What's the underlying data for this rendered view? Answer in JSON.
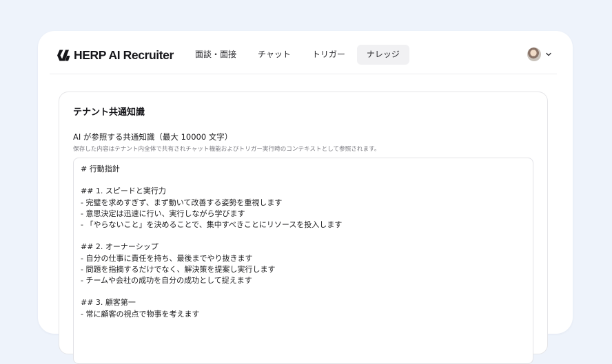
{
  "app": {
    "brand": "HERP AI Recruiter",
    "nav": [
      {
        "label": "面談・面接",
        "active": false
      },
      {
        "label": "チャット",
        "active": false
      },
      {
        "label": "トリガー",
        "active": false
      },
      {
        "label": "ナレッジ",
        "active": true
      }
    ]
  },
  "knowledge": {
    "section_title": "テナント共通知識",
    "field_label": "AI が参照する共通知識（最大 10000 文字）",
    "field_description": "保存した内容はテナント内全体で共有されチャット機能およびトリガー実行時のコンテキストとして参照されます。",
    "content": "# 行動指針\n\n## 1. スピードと実行力\n- 完璧を求めすぎず、まず動いて改善する姿勢を重視します\n- 意思決定は迅速に行い、実行しながら学びます\n- 「やらないこと」を決めることで、集中すべきことにリソースを投入します\n\n## 2. オーナーシップ\n- 自分の仕事に責任を持ち、最後までやり抜きます\n- 問題を指摘するだけでなく、解決策を提案し実行します\n- チームや会社の成功を自分の成功として捉えます\n\n## 3. 顧客第一\n- 常に顧客の視点で物事を考えます"
  },
  "colors": {
    "page_background": "#eef3fb",
    "card_background": "#ffffff",
    "active_tab_background": "#f1f1f3"
  },
  "icons": {
    "logo": "herp-logo-icon",
    "user_menu": "chevron-down-icon"
  }
}
